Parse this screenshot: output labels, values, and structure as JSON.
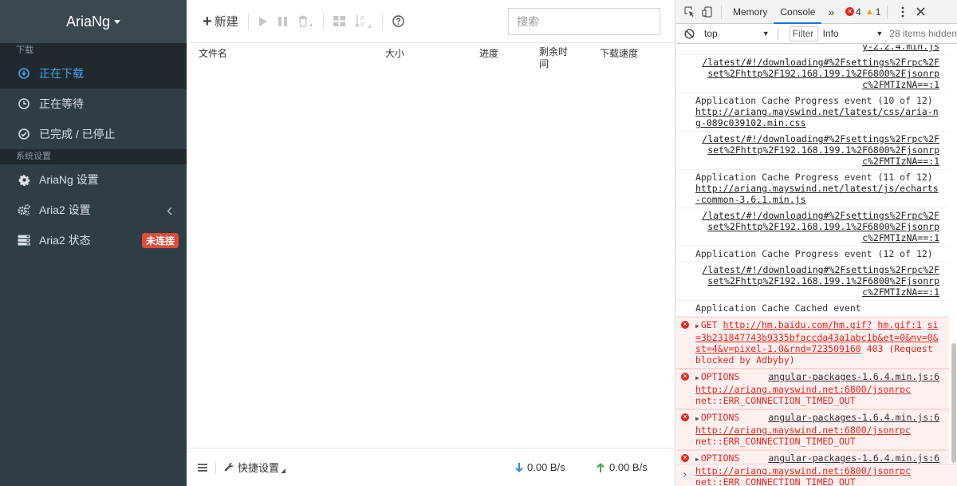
{
  "sidebar": {
    "brand": "AriaNg",
    "section_download": "下载",
    "downloading": "正在下载",
    "waiting": "正在等待",
    "stopped": "已完成 / 已停止",
    "section_settings": "系统设置",
    "ariang_settings": "AriaNg 设置",
    "aria2_settings": "Aria2 设置",
    "aria2_status": "Aria2 状态",
    "status_badge": "未连接"
  },
  "toolbar": {
    "new_label": "新建",
    "search_placeholder": "搜索"
  },
  "columns": {
    "name": "文件名",
    "size": "大小",
    "progress": "进度",
    "remaining_line1": "剩余时",
    "remaining_line2": "间",
    "speed": "下载速度"
  },
  "footer": {
    "quick_settings": "快捷设置",
    "download_speed": "0.00 B/s",
    "upload_speed": "0.00 B/s"
  },
  "devtools": {
    "tab_memory": "Memory",
    "tab_console": "Console",
    "more": "»",
    "error_count": "4",
    "warning_count": "1",
    "context": "top",
    "filter_placeholder": "Filter",
    "level": "Info",
    "hidden_count": "28 items hidden",
    "messages": {
      "m0": "y-2.2.4.min.js",
      "m1": "/latest/#!/downloading#%2Fsettings%2Frpc%2Fset%2Fhttp%2F192.168.199.1%2F6800%2Fjsonrpc%2FMTIzNA==:1",
      "m2_text": "Application Cache Progress event (10 of 12) ",
      "m2_link": "http://ariang.mayswind.net/latest/css/aria-ng-089c039102.min.css",
      "m3": "/latest/#!/downloading#%2Fsettings%2Frpc%2Fset%2Fhttp%2F192.168.199.1%2F6800%2Fjsonrpc%2FMTIzNA==:1",
      "m4_text": "Application Cache Progress event (11 of 12) ",
      "m4_link": "http://ariang.mayswind.net/latest/js/echarts-common-3.6.1.min.js",
      "m5": "/latest/#!/downloading#%2Fsettings%2Frpc%2Fset%2Fhttp%2F192.168.199.1%2F6800%2Fjsonrpc%2FMTIzNA==:1",
      "m6_text": "Application Cache Progress event (12 of 12)",
      "m7": "/latest/#!/downloading#%2Fsettings%2Frpc%2Fset%2Fhttp%2F192.168.199.1%2F6800%2Fjsonrpc%2FMTIzNA==:1",
      "m8_text": "Application Cache Cached event",
      "e1_method": "GET",
      "e1_url": "http://hm.baidu.com/hm.gif?",
      "e1_src": "hm.gif:1",
      "e1_query": "si=3b231847743b9335bfaccda43a1abc1b&et=0&nv=0&st=4&v=pixel-1.0&rnd=723509160",
      "e1_status": "403",
      "e1_reason": "(Request blocked by Adbyby)",
      "e2_method": "OPTIONS",
      "e2_src": "angular-packages-1.6.4.min.js:6",
      "e2_url": "http://ariang.mayswind.net:6800/jsonrpc",
      "e2_error": "net::ERR_CONNECTION_TIMED_OUT",
      "e3_method": "OPTIONS",
      "e3_src": "angular-packages-1.6.4.min.js:6",
      "e3_url": "http://ariang.mayswind.net:6800/jsonrpc",
      "e3_error": "net::ERR_CONNECTION_TIMED_OUT",
      "e4_method": "OPTIONS",
      "e4_src": "angular-packages-1.6.4.min.js:6",
      "e4_url": "http://ariang.mayswind.net:6800/jsonrpc",
      "e4_error": "net::ERR_CONNECTION_TIMED_OUT"
    },
    "prompt": "›"
  },
  "colors": {
    "sidebar_bg": "#2f3d44",
    "accent": "#4aa3f0",
    "badge": "#dd4b39",
    "error": "#e0261b"
  }
}
